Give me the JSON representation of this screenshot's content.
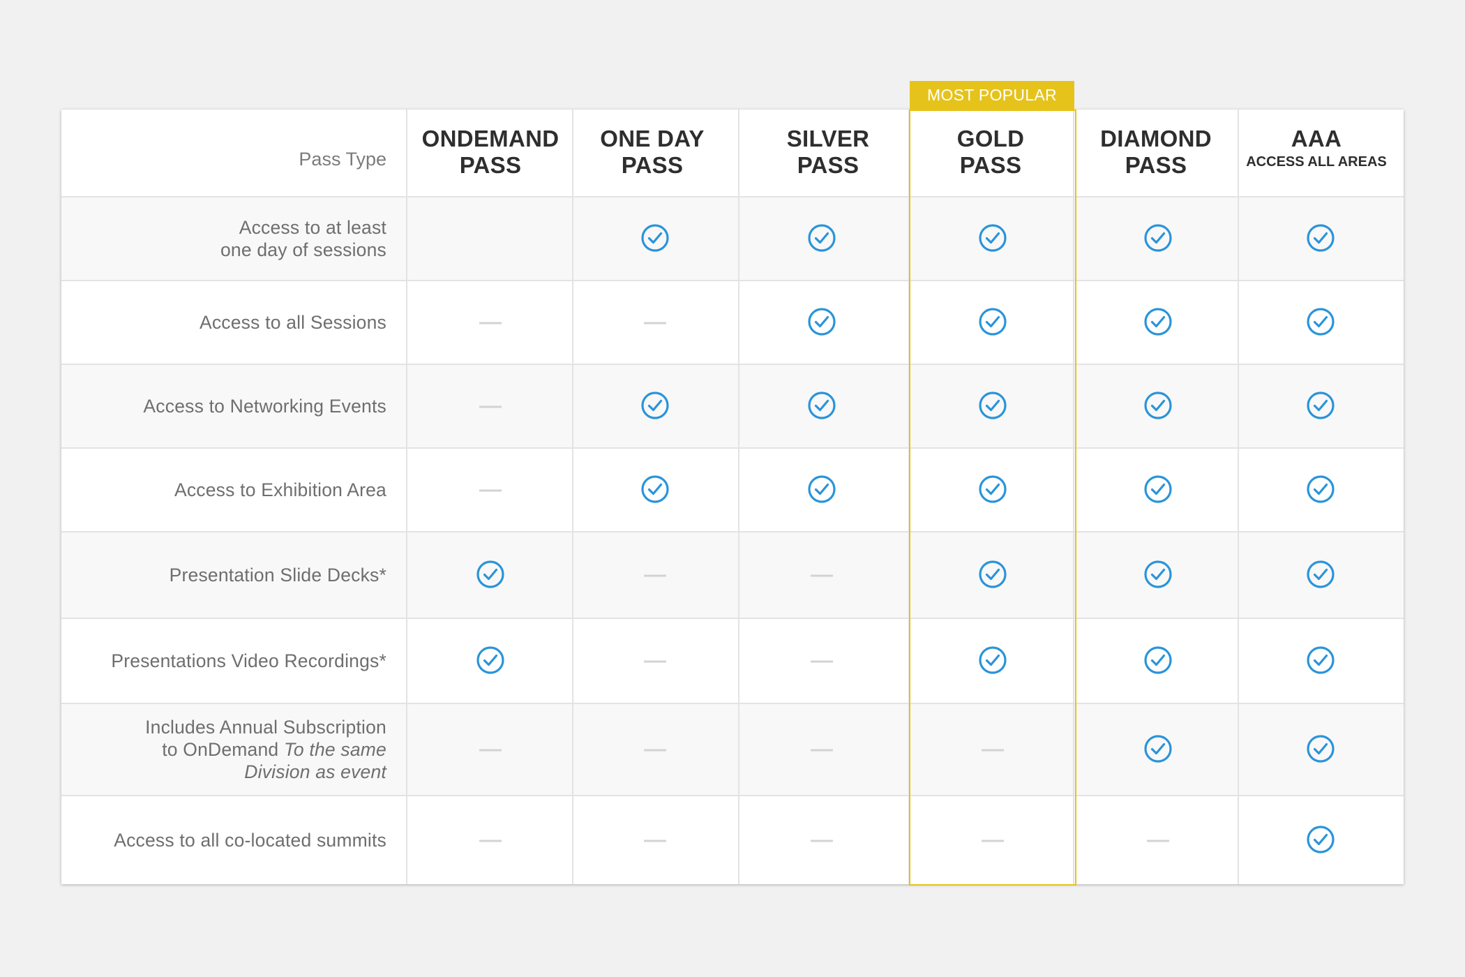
{
  "badge": "MOST POPULAR",
  "pass_type_label": "Pass Type",
  "columns": [
    {
      "id": "ondemand",
      "line1": "ONDEMAND",
      "line2": "PASS"
    },
    {
      "id": "oneday",
      "line1": "ONE DAY",
      "line2": "PASS"
    },
    {
      "id": "silver",
      "line1": "SILVER",
      "line2": "PASS"
    },
    {
      "id": "gold",
      "line1": "GOLD",
      "line2": "PASS"
    },
    {
      "id": "diamond",
      "line1": "DIAMOND",
      "line2": "PASS"
    },
    {
      "id": "aaa",
      "line1": "AAA",
      "line2": "ACCESS ALL AREAS"
    }
  ],
  "rows": [
    {
      "label_lines": [
        "Access to at least",
        "one day of sessions"
      ],
      "italic_tail": "",
      "cells": [
        "none",
        "check",
        "check",
        "check",
        "check",
        "check"
      ]
    },
    {
      "label_lines": [
        "Access to all Sessions"
      ],
      "italic_tail": "",
      "cells": [
        "dash",
        "dash",
        "check",
        "check",
        "check",
        "check"
      ]
    },
    {
      "label_lines": [
        "Access to Networking Events"
      ],
      "italic_tail": "",
      "cells": [
        "dash",
        "check",
        "check",
        "check",
        "check",
        "check"
      ]
    },
    {
      "label_lines": [
        "Access to Exhibition Area"
      ],
      "italic_tail": "",
      "cells": [
        "dash",
        "check",
        "check",
        "check",
        "check",
        "check"
      ]
    },
    {
      "label_lines": [
        "Presentation Slide Decks*"
      ],
      "italic_tail": "",
      "cells": [
        "check",
        "dash",
        "dash",
        "check",
        "check",
        "check"
      ]
    },
    {
      "label_lines": [
        "Presentations Video Recordings*"
      ],
      "italic_tail": "",
      "cells": [
        "check",
        "dash",
        "dash",
        "check",
        "check",
        "check"
      ]
    },
    {
      "label_lines": [
        "Includes Annual Subscription",
        "to OnDemand"
      ],
      "italic_tail": "To the same Division as event",
      "cells": [
        "dash",
        "dash",
        "dash",
        "dash",
        "check",
        "check"
      ]
    },
    {
      "label_lines": [
        "Access to all co-located summits"
      ],
      "italic_tail": "",
      "cells": [
        "dash",
        "dash",
        "dash",
        "dash",
        "dash",
        "check"
      ]
    }
  ],
  "colors": {
    "accent_check": "#2a94d9",
    "popular_gold": "#e6c31b",
    "dash": "#d3d3d3"
  },
  "icons": {
    "included": "check-circle-icon",
    "excluded": "dash-icon"
  }
}
